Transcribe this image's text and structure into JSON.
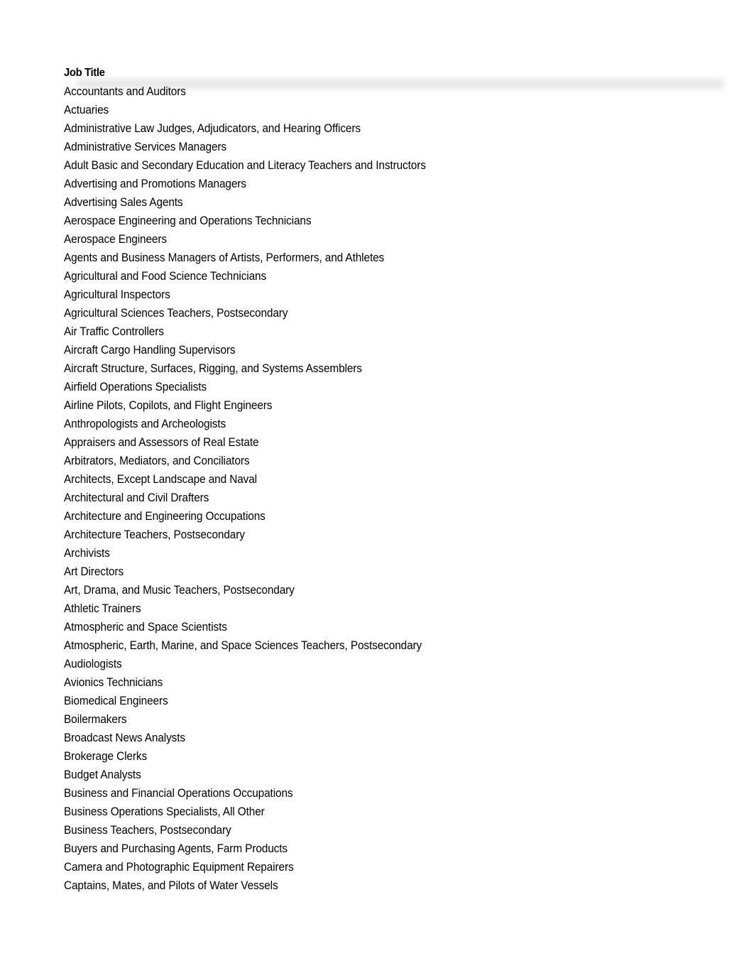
{
  "table": {
    "header": "Job Title",
    "rows": [
      "Accountants and Auditors",
      "Actuaries",
      "Administrative Law Judges, Adjudicators, and Hearing Officers",
      "Administrative Services Managers",
      "Adult Basic and Secondary Education and Literacy Teachers and Instructors",
      "Advertising and Promotions Managers",
      "Advertising Sales Agents",
      "Aerospace Engineering and Operations Technicians",
      "Aerospace Engineers",
      "Agents and Business Managers of Artists, Performers, and Athletes",
      "Agricultural and Food Science Technicians",
      "Agricultural Inspectors",
      "Agricultural Sciences Teachers, Postsecondary",
      "Air Traffic Controllers",
      "Aircraft Cargo Handling Supervisors",
      "Aircraft Structure, Surfaces, Rigging, and Systems Assemblers",
      "Airfield Operations Specialists",
      "Airline Pilots, Copilots, and Flight Engineers",
      "Anthropologists and Archeologists",
      "Appraisers and Assessors of Real Estate",
      "Arbitrators, Mediators, and Conciliators",
      "Architects, Except Landscape and Naval",
      "Architectural and Civil Drafters",
      "Architecture and Engineering Occupations",
      "Architecture Teachers, Postsecondary",
      "Archivists",
      "Art Directors",
      "Art, Drama, and Music Teachers, Postsecondary",
      "Athletic Trainers",
      "Atmospheric and Space Scientists",
      "Atmospheric, Earth, Marine, and Space Sciences Teachers, Postsecondary",
      "Audiologists",
      "Avionics Technicians",
      "Biomedical Engineers",
      "Boilermakers",
      "Broadcast News Analysts",
      "Brokerage Clerks",
      "Budget Analysts",
      "Business and Financial Operations Occupations",
      "Business Operations Specialists, All Other",
      "Business Teachers, Postsecondary",
      "Buyers and Purchasing Agents, Farm Products",
      "Camera and Photographic Equipment Repairers",
      "Captains, Mates, and Pilots of Water Vessels"
    ]
  }
}
